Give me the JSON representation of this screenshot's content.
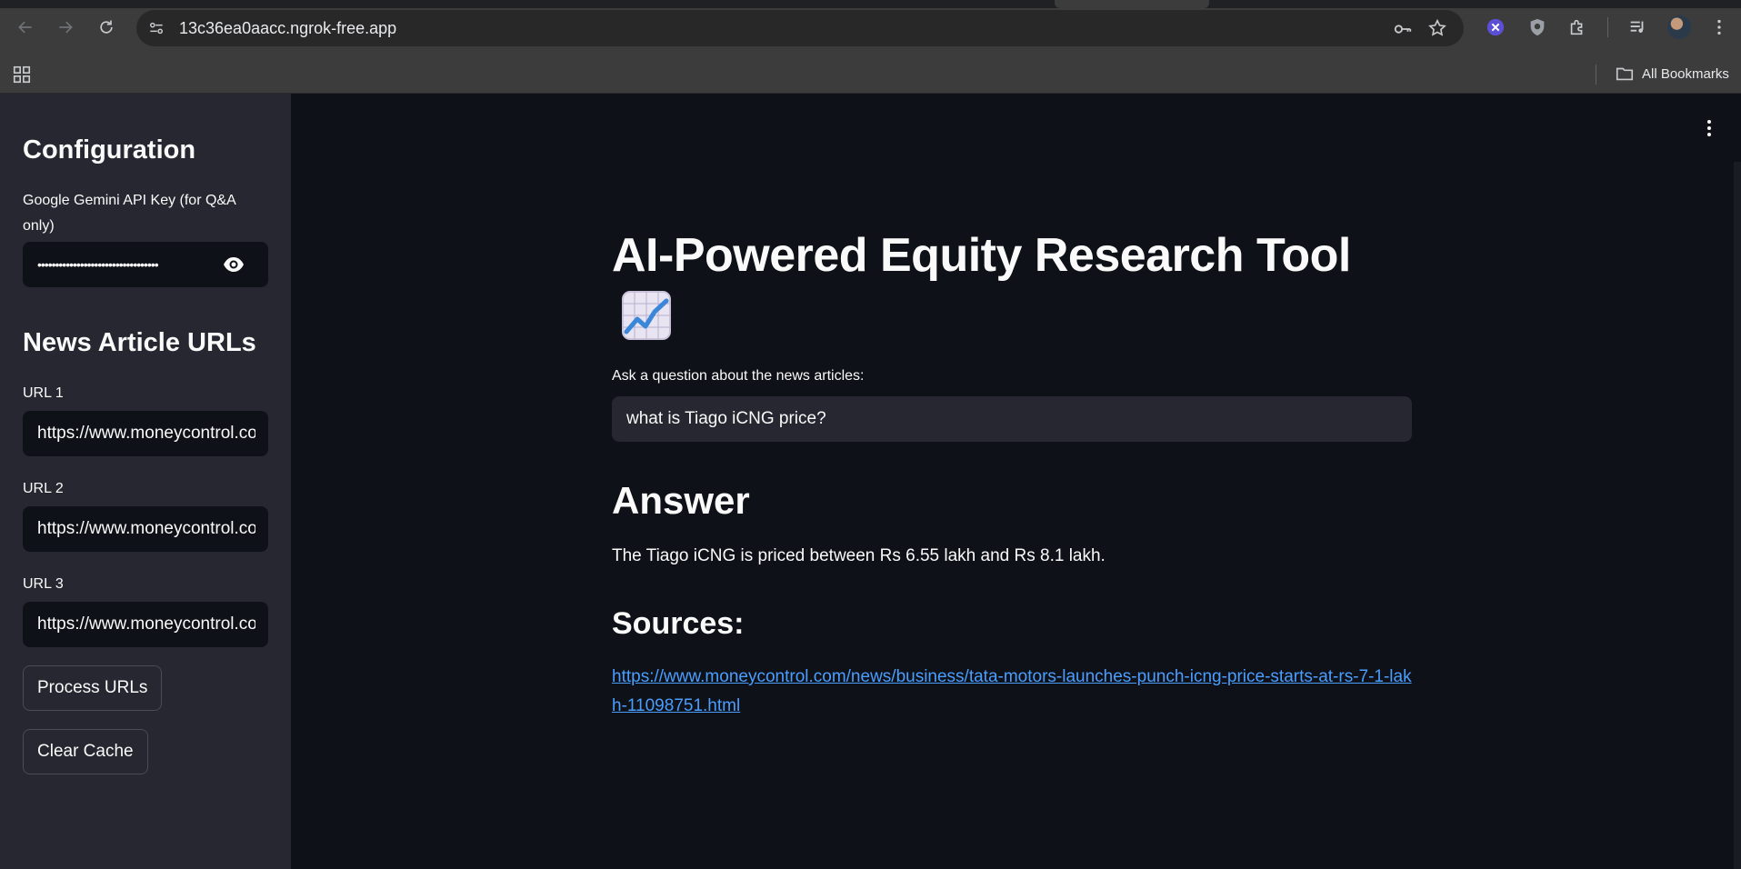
{
  "browser": {
    "url": "13c36ea0aacc.ngrok-free.app",
    "bookmarks_label": "All Bookmarks"
  },
  "sidebar": {
    "configuration_heading": "Configuration",
    "api_key_label": "Google Gemini API Key (for Q&A only)",
    "api_key_value": "••••••••••••••••••••••••••••••••••",
    "urls_heading": "News Article URLs",
    "url_fields": [
      {
        "label": "URL 1",
        "value": "https://www.moneycontrol.com"
      },
      {
        "label": "URL 2",
        "value": "https://www.moneycontrol.com"
      },
      {
        "label": "URL 3",
        "value": "https://www.moneycontrol.com"
      }
    ],
    "process_button": "Process URLs",
    "clear_button": "Clear Cache"
  },
  "main": {
    "title": "AI-Powered Equity Research Tool",
    "question_label": "Ask a question about the news articles:",
    "question_value": "what is Tiago iCNG price?",
    "answer_heading": "Answer",
    "answer_text": "The Tiago iCNG is priced between Rs 6.55 lakh and Rs 8.1 lakh.",
    "sources_heading": "Sources:",
    "source_link": "https://www.moneycontrol.com/news/business/tata-motors-launches-punch-icng-price-starts-at-rs-7-1-lakh-11098751.html"
  },
  "colors": {
    "sidebar_bg": "#262730",
    "main_bg": "#0e1117",
    "link": "#4a9eff"
  }
}
